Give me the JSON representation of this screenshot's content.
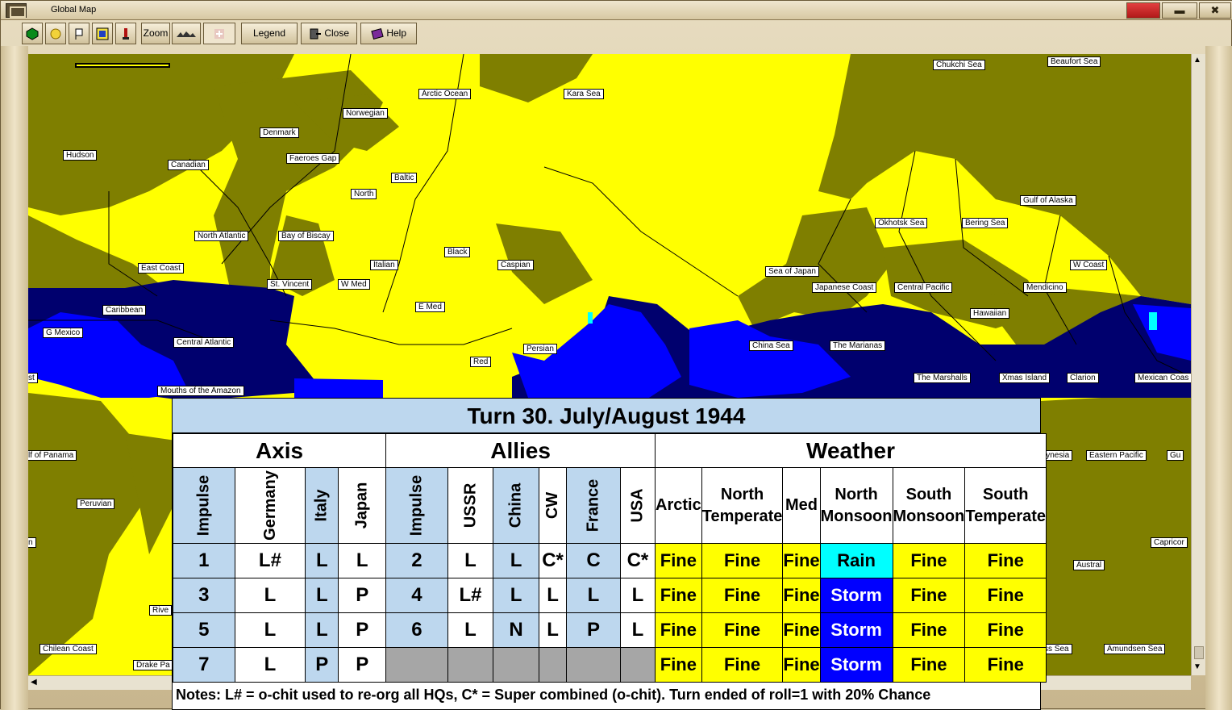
{
  "window": {
    "title": "Global Map"
  },
  "toolbar": {
    "zoom_label": "Zoom",
    "legend_label": "Legend",
    "close_label": "Close",
    "help_label": "Help"
  },
  "map": {
    "labels": {
      "chukchi_sea": "Chukchi Sea",
      "beaufort_sea": "Beaufort Sea",
      "arctic_ocean": "Arctic Ocean",
      "kara_sea": "Kara Sea",
      "norwegian": "Norwegian",
      "denmark": "Denmark",
      "hudson": "Hudson",
      "canadian": "Canadian",
      "faeroes_gap": "Faeroes Gap",
      "baltic": "Baltic",
      "north": "North",
      "gulf_of_alaska": "Gulf of Alaska",
      "okhotsk_sea": "Okhotsk Sea",
      "bering_sea": "Bering Sea",
      "north_atlantic": "North Atlantic",
      "bay_of_biscay": "Bay of Biscay",
      "black": "Black",
      "east_coast": "East Coast",
      "italian": "Italian",
      "caspian": "Caspian",
      "sea_of_japan": "Sea of Japan",
      "w_coast": "W Coast",
      "st_vincent": "St. Vincent",
      "w_med": "W Med",
      "japanese_coast": "Japanese Coast",
      "central_pacific": "Central Pacific",
      "mendicino": "Mendicino",
      "caribbean": "Caribbean",
      "e_med": "E Med",
      "hawaiian": "Hawaiian",
      "g_mexico": "G Mexico",
      "central_atlantic": "Central Atlantic",
      "persian": "Persian",
      "china_sea": "China Sea",
      "the_marianas": "The Marianas",
      "red": "Red",
      "the_marshalls": "The Marshalls",
      "xmas_island": "Xmas Island",
      "clarion": "Clarion",
      "mexican_coast": "Mexican Coas",
      "st": "st",
      "mouths_amazon": "Mouths of the Amazon",
      "gulf_panama": "lf of Panama",
      "polynesia": "lynesia",
      "eastern_pacific": "Eastern Pacific",
      "gu": "Gu",
      "peruvian": "Peruvian",
      "capricorn": "Capricor",
      "austral": "Austral",
      "river": "Rive",
      "chilean_coast": "Chilean Coast",
      "drake": "Drake Pa",
      "ross_sea": "ss Sea",
      "amundsen_sea": "Amundsen Sea",
      "n": "n"
    }
  },
  "turn": {
    "title": "Turn 30.  July/August 1944",
    "axis_label": "Axis",
    "allies_label": "Allies",
    "weather_label": "Weather",
    "axis_cols": [
      "Impulse",
      "Germany",
      "Italy",
      "Japan"
    ],
    "allies_cols": [
      "Impulse",
      "USSR",
      "China",
      "CW",
      "France",
      "USA"
    ],
    "weather_cols": [
      [
        "Arctic",
        ""
      ],
      [
        "North",
        "Temperate"
      ],
      [
        "Med",
        ""
      ],
      [
        "North",
        "Monsoon"
      ],
      [
        "South",
        "Monsoon"
      ],
      [
        "South",
        "Temperate"
      ]
    ],
    "rows": [
      {
        "axis": [
          "1",
          "L#",
          "L",
          "L"
        ],
        "allies": [
          "2",
          "L",
          "L",
          "C*",
          "C",
          "C*"
        ],
        "weather": [
          "Fine",
          "Fine",
          "Fine",
          "Rain",
          "Fine",
          "Fine"
        ]
      },
      {
        "axis": [
          "3",
          "L",
          "L",
          "P"
        ],
        "allies": [
          "4",
          "L#",
          "L",
          "L",
          "L",
          "L"
        ],
        "weather": [
          "Fine",
          "Fine",
          "Fine",
          "Storm",
          "Fine",
          "Fine"
        ]
      },
      {
        "axis": [
          "5",
          "L",
          "L",
          "P"
        ],
        "allies": [
          "6",
          "L",
          "N",
          "L",
          "P",
          "L"
        ],
        "weather": [
          "Fine",
          "Fine",
          "Fine",
          "Storm",
          "Fine",
          "Fine"
        ]
      },
      {
        "axis": [
          "7",
          "L",
          "P",
          "P"
        ],
        "allies": [
          "",
          "",
          "",
          "",
          "",
          ""
        ],
        "weather": [
          "Fine",
          "Fine",
          "Fine",
          "Storm",
          "Fine",
          "Fine"
        ]
      }
    ],
    "notes": "Notes:  L# = o-chit used to re-org all HQs,  C* = Super combined (o-chit).   Turn ended of roll=1 with 20% Chance"
  },
  "colors": {
    "land_yellow": "#ffff00",
    "land_olive": "#7f7f00",
    "sea_navy": "#00006e",
    "sea_blue": "#0000ff",
    "header_blue": "#bdd7ee",
    "storm": "#0000ff",
    "rain": "#00ffff",
    "fine": "#ffff00"
  }
}
